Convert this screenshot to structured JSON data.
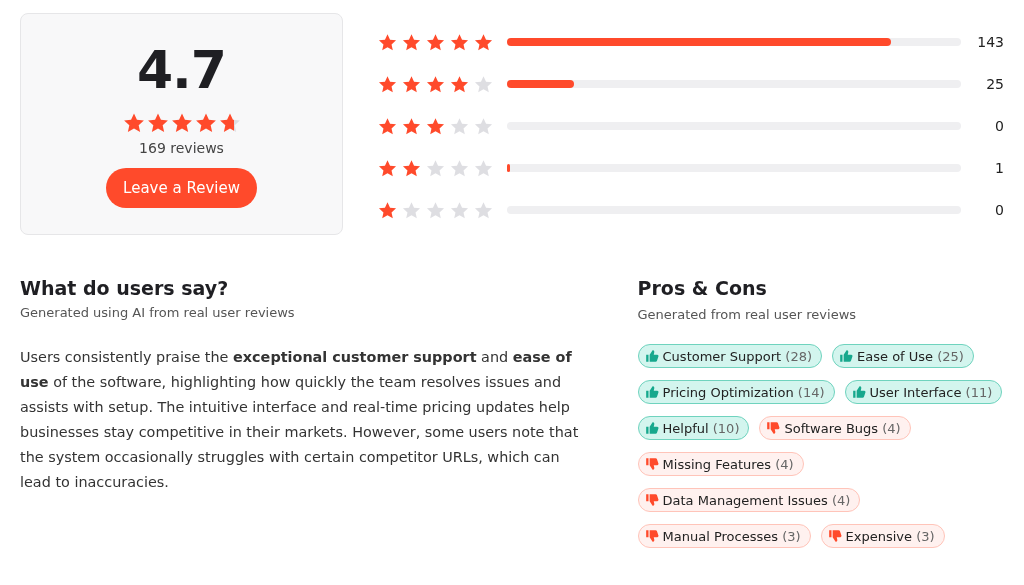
{
  "summary": {
    "score": "4.7",
    "stars": 4.7,
    "review_count": "169 reviews",
    "button": "Leave a Review"
  },
  "distribution": [
    {
      "stars": 5,
      "level": 0.845,
      "count": "143"
    },
    {
      "stars": 4,
      "level": 0.148,
      "count": "25"
    },
    {
      "stars": 3,
      "level": 0,
      "count": "0"
    },
    {
      "stars": 2,
      "level": 0.006,
      "count": "1"
    },
    {
      "stars": 1,
      "level": 0,
      "count": "0"
    }
  ],
  "users_say": {
    "title": "What do users say?",
    "subtitle": "Generated using AI from real user reviews",
    "text": "Users consistently praise the **exceptional customer support** and **ease of use** of the software, highlighting how quickly the team resolves issues and assists with setup. The intuitive interface and real-time pricing updates help businesses stay competitive in their markets. However, some users note that the system occasionally struggles with certain competitor URLs, which can lead to inaccuracies."
  },
  "pros_cons": {
    "title": "Pros & Cons",
    "subtitle": "Generated from real user reviews",
    "tags": [
      {
        "kind": "pro",
        "label": "Customer Support",
        "count": "(28)"
      },
      {
        "kind": "pro",
        "label": "Ease of Use",
        "count": "(25)"
      },
      {
        "kind": "pro",
        "label": "Pricing Optimization",
        "count": "(14)"
      },
      {
        "kind": "pro",
        "label": "User Interface",
        "count": "(11)"
      },
      {
        "kind": "pro",
        "label": "Helpful",
        "count": "(10)"
      },
      {
        "kind": "con",
        "label": "Software Bugs",
        "count": "(4)"
      },
      {
        "kind": "con",
        "label": "Missing Features",
        "count": "(4)"
      },
      {
        "kind": "con",
        "label": "Data Management Issues",
        "count": "(4)"
      },
      {
        "kind": "con",
        "label": "Manual Processes",
        "count": "(3)"
      },
      {
        "kind": "con",
        "label": "Expensive",
        "count": "(3)"
      }
    ]
  }
}
